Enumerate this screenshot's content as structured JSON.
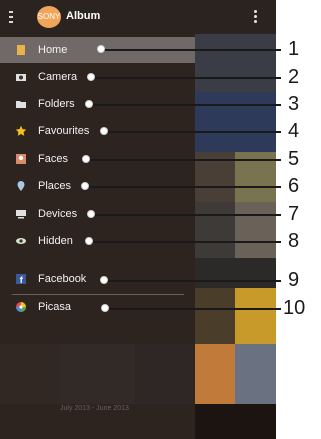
{
  "header": {
    "title": "Album",
    "logo_text": "SONY"
  },
  "drawer": {
    "items": [
      {
        "label": "Home",
        "icon": "home-icon",
        "selected": true
      },
      {
        "label": "Camera",
        "icon": "camera-icon"
      },
      {
        "label": "Folders",
        "icon": "folder-icon"
      },
      {
        "label": "Favourites",
        "icon": "star-icon"
      },
      {
        "label": "Faces",
        "icon": "face-icon"
      },
      {
        "label": "Places",
        "icon": "location-pin-icon"
      },
      {
        "label": "Devices",
        "icon": "devices-icon"
      },
      {
        "label": "Hidden",
        "icon": "eye-icon"
      },
      {
        "label": "Facebook",
        "icon": "facebook-icon"
      },
      {
        "label": "Picasa",
        "icon": "picasa-icon"
      }
    ]
  },
  "date_range": "July 2013 - June 2013",
  "callouts": [
    "1",
    "2",
    "3",
    "4",
    "5",
    "6",
    "7",
    "8",
    "9",
    "10"
  ],
  "colors": {
    "accent_orange": "#f0a55a",
    "star": "#f4c21a",
    "facebook": "#3b5998"
  }
}
